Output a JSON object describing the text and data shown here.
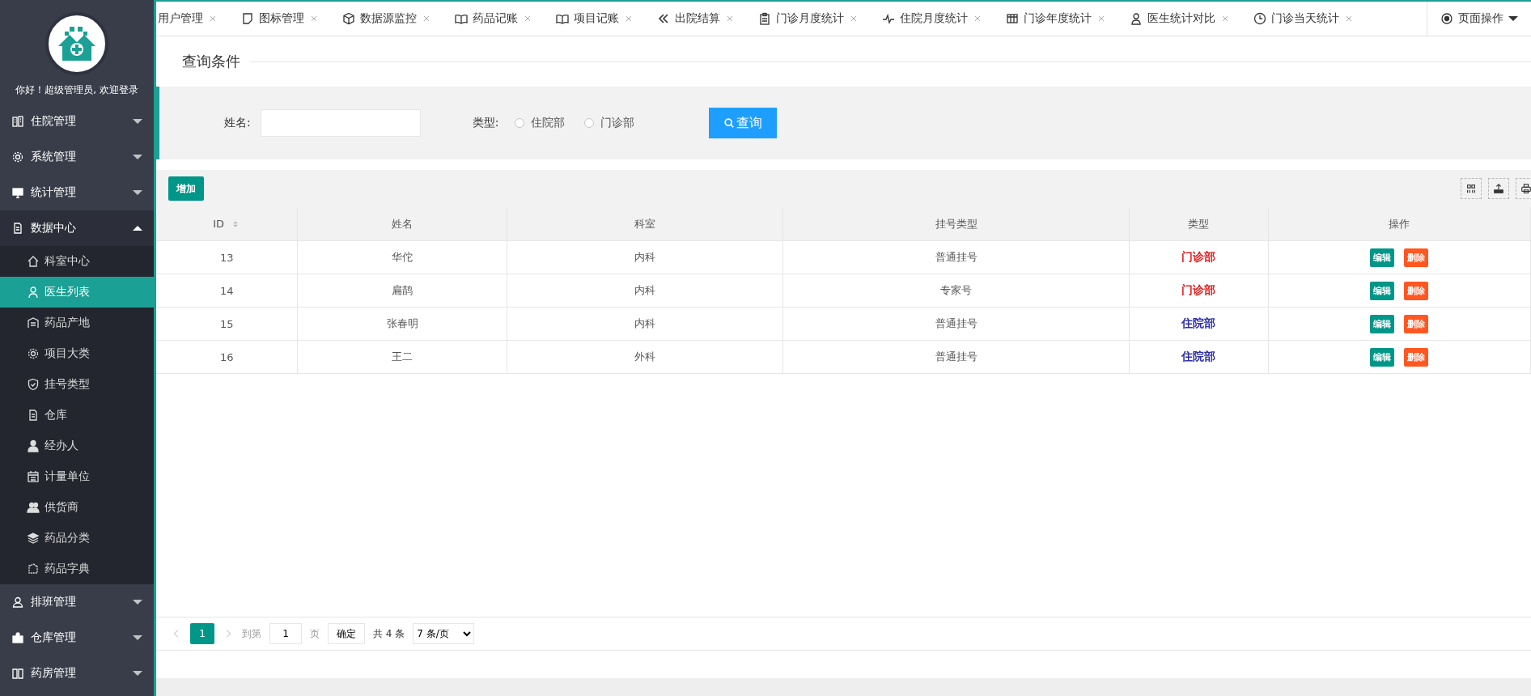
{
  "sidebar": {
    "greeting": "你好！超级管理员, 欢迎登录",
    "menu": [
      {
        "label": "住院管理",
        "expanded": false
      },
      {
        "label": "系统管理",
        "expanded": false
      },
      {
        "label": "统计管理",
        "expanded": false
      },
      {
        "label": "数据中心",
        "expanded": true,
        "children": [
          {
            "label": "科室中心",
            "selected": false
          },
          {
            "label": "医生列表",
            "selected": true
          },
          {
            "label": "药品产地",
            "selected": false
          },
          {
            "label": "项目大类",
            "selected": false
          },
          {
            "label": "挂号类型",
            "selected": false
          },
          {
            "label": "仓库",
            "selected": false
          },
          {
            "label": "经办人",
            "selected": false
          },
          {
            "label": "计量单位",
            "selected": false
          },
          {
            "label": "供货商",
            "selected": false
          },
          {
            "label": "药品分类",
            "selected": false
          },
          {
            "label": "药品字典",
            "selected": false
          }
        ]
      },
      {
        "label": "排班管理",
        "expanded": false
      },
      {
        "label": "仓库管理",
        "expanded": false
      },
      {
        "label": "药房管理",
        "expanded": false
      }
    ]
  },
  "tabs": [
    {
      "label": "用户管理"
    },
    {
      "label": "图标管理"
    },
    {
      "label": "数据源监控"
    },
    {
      "label": "药品记账"
    },
    {
      "label": "项目记账"
    },
    {
      "label": "出院结算"
    },
    {
      "label": "门诊月度统计"
    },
    {
      "label": "住院月度统计"
    },
    {
      "label": "门诊年度统计"
    },
    {
      "label": "医生统计对比"
    },
    {
      "label": "门诊当天统计"
    }
  ],
  "page_actions": "页面操作",
  "query": {
    "title": "查询条件",
    "name_label": "姓名:",
    "type_label": "类型:",
    "options": [
      {
        "label": "住院部",
        "selected": false
      },
      {
        "label": "门诊部",
        "selected": false
      }
    ],
    "search_button": "查询"
  },
  "add_button": "增加",
  "table": {
    "columns": [
      "ID",
      "姓名",
      "科室",
      "挂号类型",
      "类型",
      "操作"
    ],
    "rows": [
      {
        "id": "13",
        "name": "华佗",
        "dept": "内科",
        "reg_type": "普通挂号",
        "type": "门诊部",
        "color": "#e02020",
        "actions": [
          "编辑",
          "删除"
        ]
      },
      {
        "id": "14",
        "name": "扁鹊",
        "dept": "内科",
        "reg_type": "专家号",
        "type": "门诊部",
        "color": "#e02020",
        "actions": [
          "编辑",
          "删除"
        ]
      },
      {
        "id": "15",
        "name": "张春明",
        "dept": "内科",
        "reg_type": "普通挂号",
        "type": "住院部",
        "color": "#2d2fa8",
        "actions": [
          "编辑",
          "删除"
        ]
      },
      {
        "id": "16",
        "name": "王二",
        "dept": "外科",
        "reg_type": "普通挂号",
        "type": "住院部",
        "color": "#2d2fa8",
        "actions": [
          "编辑",
          "删除"
        ]
      }
    ]
  },
  "pagination": {
    "pages": [
      {
        "label": "1",
        "selected": true
      }
    ],
    "goto_label": "到第",
    "goto_value": "1",
    "page_unit": "页",
    "confirm": "确定",
    "total": "共 4 条",
    "page_size": "7 条/页"
  }
}
